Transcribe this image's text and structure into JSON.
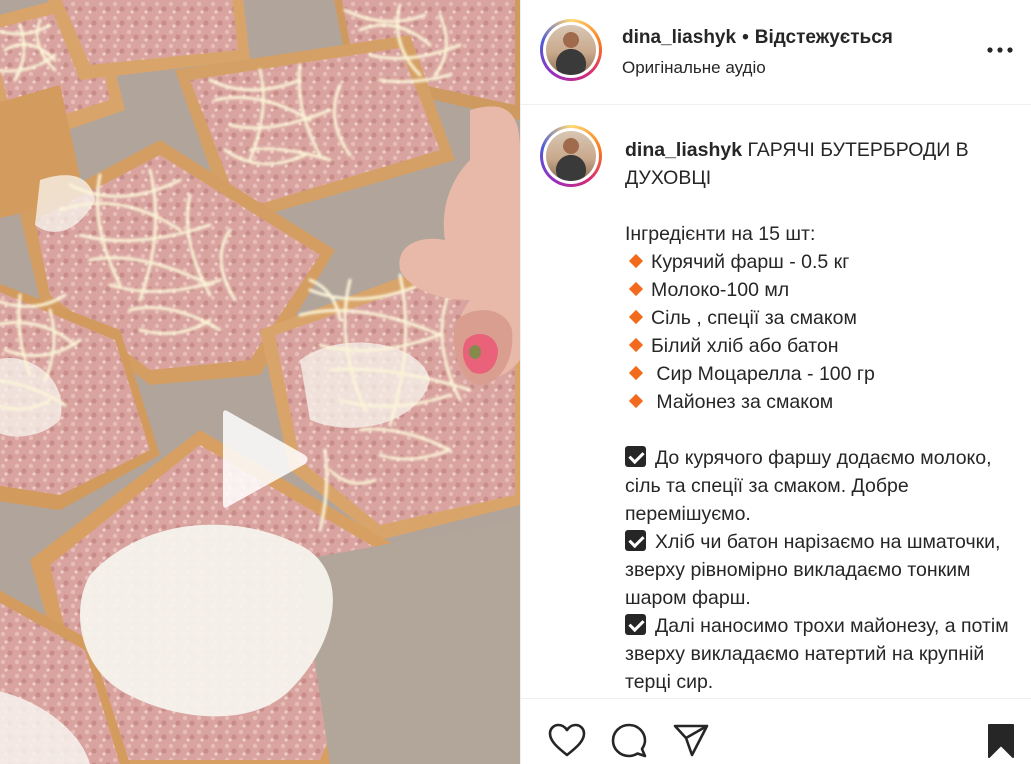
{
  "post": {
    "username": "dina_liashyk",
    "separator": "•",
    "follow_status": "Відстежується",
    "audio": "Оригінальне аудіо"
  },
  "caption": {
    "username": "dina_liashyk",
    "title": " ГАРЯЧІ БУТЕРБРОДИ В ДУХОВЦІ",
    "ingredients_heading": "Інгредієнти на 15 шт:",
    "ingredients": [
      "Курячий фарш - 0.5 кг",
      "Молоко-100 мл",
      "Сіль , спеції за смаком",
      "Білий хліб або батон",
      " Сир Моцарелла - 100 гр",
      " Майонез за смаком"
    ],
    "steps": [
      "До курячого фаршу додаємо молоко, сіль та спеції за смаком. Добре перемішуємо.",
      "Хліб чи батон нарізаємо на шматочки, зверху рівномірно викладаємо тонким шаром фарш.",
      "Далі наносимо трохи майонезу, а потім зверху викладаємо натертий на крупній терці сир."
    ]
  },
  "icons": {
    "more": "more-horizontal-icon",
    "play": "play-icon",
    "like": "heart-icon",
    "comment": "comment-icon",
    "share": "send-icon",
    "save": "bookmark-icon"
  },
  "colors": {
    "bullet": "#f26b1d",
    "text": "#262626",
    "divider": "#efefef"
  }
}
